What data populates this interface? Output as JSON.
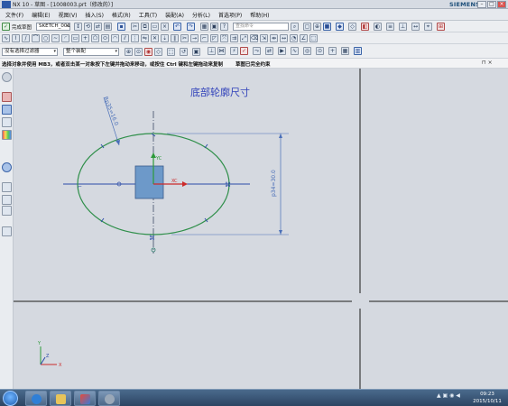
{
  "window": {
    "title": "NX 10 - 草图 - [1008003.prt（修改的）]",
    "brand": "SIEMENS",
    "controls": [
      "–",
      "□",
      "×"
    ]
  },
  "menu": {
    "items": [
      "文件(F)",
      "编辑(E)",
      "视图(V)",
      "插入(S)",
      "格式(R)",
      "工具(T)",
      "装配(A)",
      "分析(L)",
      "首选项(P)",
      "帮助(H)"
    ]
  },
  "toolbar": {
    "finish_sketch_label": "完成草图",
    "sketch_name": "SKETCH_001",
    "search_placeholder": "查找命令"
  },
  "filterbar": {
    "selection_filter": "没有选择过滤器",
    "assembly_scope": "整个装配"
  },
  "cue": {
    "prompt": "选择对象并使用 MB3，或者双击某一对象",
    "hint": "按下左键并拖动来移动，或按住 Ctrl 键和左键拖动来复制",
    "status": "草图已完全约束"
  },
  "canvas": {
    "annotation": "底部轮廓尺寸",
    "dim_radius": "Rp35=16.0",
    "dim_height": "p34=30.0",
    "axis_x": "XC",
    "axis_y": "YC",
    "triad_x": "X",
    "triad_y": "Y",
    "triad_z": "Z"
  },
  "taskbar": {
    "time": "09:23",
    "date": "2015/10/11"
  },
  "colors": {
    "canvas_bg": "#d5d9e0",
    "sketch_curve": "#2f8f4a",
    "dimension": "#4a6fb8",
    "annotation_text": "#3344bb",
    "rect_fill": "#6d99c9"
  }
}
